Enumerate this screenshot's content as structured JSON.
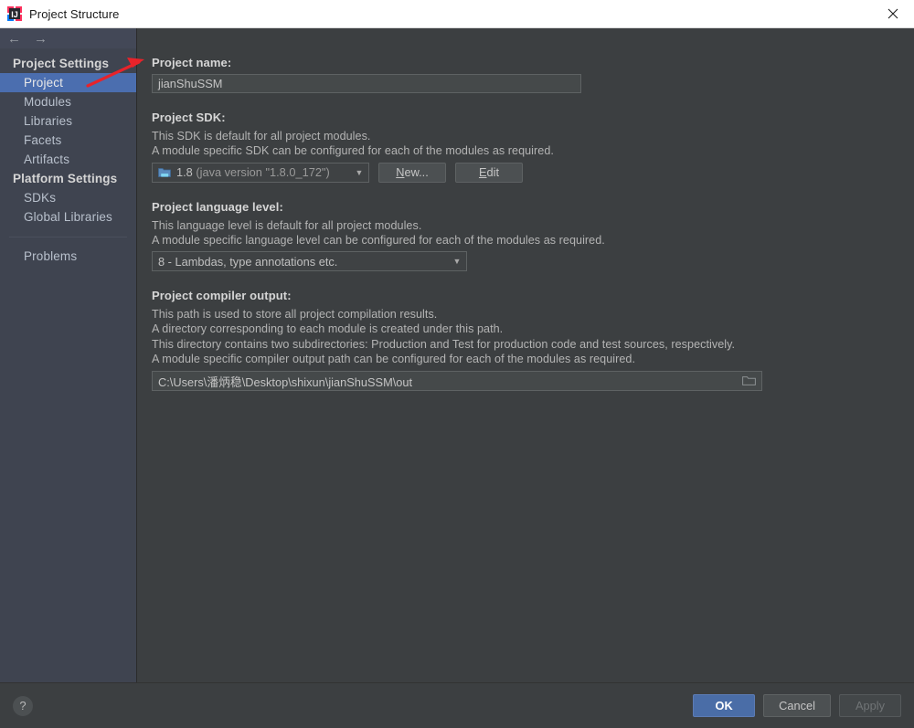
{
  "window": {
    "title": "Project Structure",
    "app_icon": "intellij-idea-logo-icon",
    "close_icon": "close-icon"
  },
  "sidebar": {
    "nav": {
      "back_icon": "arrow-left-icon",
      "forward_icon": "arrow-right-icon"
    },
    "groups": [
      {
        "label": "Project Settings",
        "items": [
          {
            "label": "Project",
            "selected": true
          },
          {
            "label": "Modules",
            "selected": false
          },
          {
            "label": "Libraries",
            "selected": false
          },
          {
            "label": "Facets",
            "selected": false
          },
          {
            "label": "Artifacts",
            "selected": false
          }
        ]
      },
      {
        "label": "Platform Settings",
        "items": [
          {
            "label": "SDKs",
            "selected": false
          },
          {
            "label": "Global Libraries",
            "selected": false
          }
        ]
      }
    ],
    "extra_items": [
      {
        "label": "Problems",
        "selected": false
      }
    ]
  },
  "main": {
    "project_name": {
      "title": "Project name:",
      "value": "jianShuSSM",
      "placeholder": ""
    },
    "project_sdk": {
      "title": "Project SDK:",
      "descriptions": [
        "This SDK is default for all project modules.",
        "A module specific SDK can be configured for each of the modules as required."
      ],
      "selected_version": "1.8",
      "selected_detail": "(java version \"1.8.0_172\")",
      "sdk_icon": "java-sdk-icon",
      "dropdown_icon": "chevron-down-icon",
      "new_button": {
        "label": "New...",
        "mnemonic": "N"
      },
      "edit_button": {
        "label": "Edit",
        "mnemonic": "E"
      }
    },
    "language_level": {
      "title": "Project language level:",
      "descriptions": [
        "This language level is default for all project modules.",
        "A module specific language level can be configured for each of the modules as required."
      ],
      "selected": "8 - Lambdas, type annotations etc.",
      "dropdown_icon": "chevron-down-icon"
    },
    "compiler_output": {
      "title": "Project compiler output:",
      "descriptions": [
        "This path is used to store all project compilation results.",
        "A directory corresponding to each module is created under this path.",
        "This directory contains two subdirectories: Production and Test for production code and test sources, respectively.",
        "A module specific compiler output path can be configured for each of the modules as required."
      ],
      "value": "C:\\Users\\潘炳稳\\Desktop\\shixun\\jianShuSSM\\out",
      "browse_icon": "folder-browse-icon"
    }
  },
  "footer": {
    "help": {
      "label": "?",
      "icon": "help-icon"
    },
    "ok": {
      "label": "OK",
      "enabled": true
    },
    "cancel": {
      "label": "Cancel",
      "enabled": true
    },
    "apply": {
      "label": "Apply",
      "enabled": false
    }
  },
  "annotation": {
    "arrow_color": "#e8232a",
    "type": "red-arrow-pointing-to-project-name-field"
  },
  "colors": {
    "accent": "#4b6eaf",
    "primary_button": "#4a6da7",
    "sidebar_bg": "#3f4450",
    "content_bg": "#3c3f41",
    "field_bg": "#45494a",
    "annotation_red": "#e8232a"
  }
}
